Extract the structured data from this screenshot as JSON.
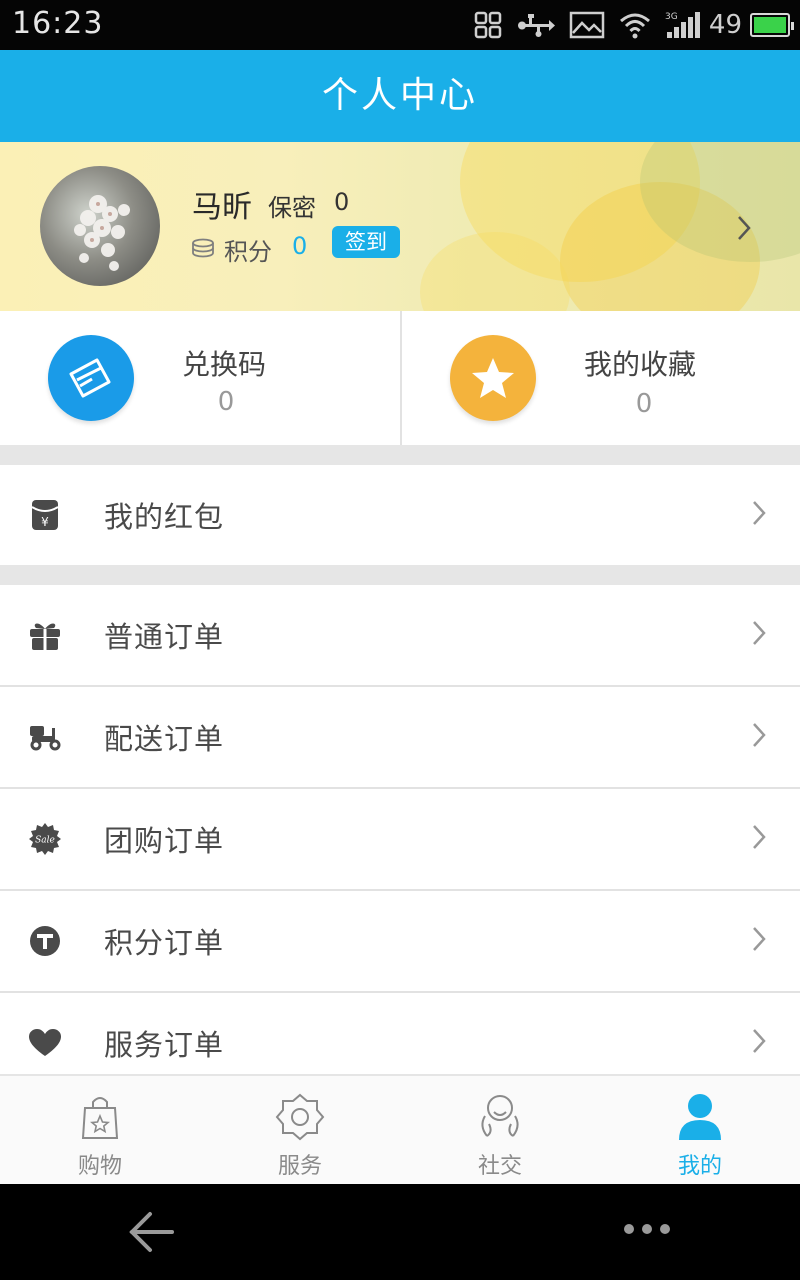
{
  "status_bar": {
    "time": "16:23",
    "battery_level": "49",
    "icons": [
      "app-grid-icon",
      "usb-icon",
      "image-icon",
      "wifi-icon",
      "signal-3g-icon",
      "battery-icon"
    ]
  },
  "header": {
    "title": "个人中心"
  },
  "profile": {
    "name": "马昕",
    "gender": "保密",
    "age": "0",
    "points_label": "积分",
    "points_value": "0",
    "signin_label": "签到"
  },
  "quick_actions": [
    {
      "label": "兑换码",
      "count": "0",
      "icon": "ticket-icon",
      "color": "#1a9be8"
    },
    {
      "label": "我的收藏",
      "count": "0",
      "icon": "star-icon",
      "color": "#f4b33c"
    }
  ],
  "menu": {
    "red_packet": {
      "label": "我的红包",
      "icon": "red-packet-icon"
    },
    "orders": [
      {
        "label": "普通订单",
        "icon": "gift-icon"
      },
      {
        "label": "配送订单",
        "icon": "scooter-icon"
      },
      {
        "label": "团购订单",
        "icon": "sale-badge-icon"
      },
      {
        "label": "积分订单",
        "icon": "t-circle-icon"
      },
      {
        "label": "服务订单",
        "icon": "heart-icon"
      }
    ]
  },
  "tabs": [
    {
      "label": "购物",
      "icon": "shopping-bag-icon",
      "active": false
    },
    {
      "label": "服务",
      "icon": "gear-service-icon",
      "active": false
    },
    {
      "label": "社交",
      "icon": "social-icon",
      "active": false
    },
    {
      "label": "我的",
      "icon": "person-icon",
      "active": true
    }
  ],
  "colors": {
    "accent": "#1aafe8",
    "ticket": "#1a9be8",
    "star": "#f4b33c"
  }
}
